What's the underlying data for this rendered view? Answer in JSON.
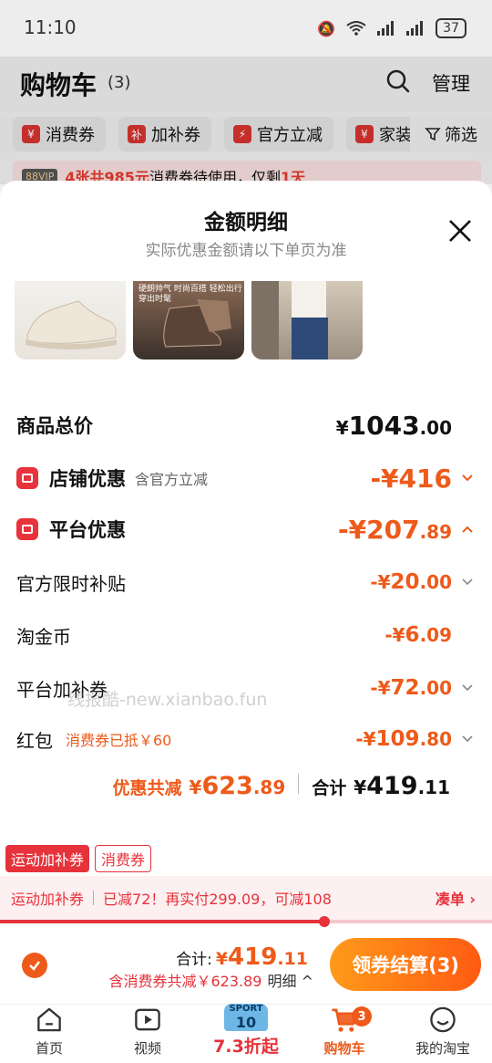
{
  "status_bar": {
    "time": "11:10",
    "battery": "37"
  },
  "header": {
    "title": "购物车",
    "count": "(3)",
    "manage": "管理"
  },
  "chips": [
    {
      "badge": "¥",
      "label": "消费券"
    },
    {
      "badge": "补",
      "label": "加补券"
    },
    {
      "badge": "⚡",
      "label": "官方立减"
    },
    {
      "badge": "¥",
      "label": "家装"
    }
  ],
  "filter_label": "筛选",
  "vip_bar": {
    "badge": "88VIP",
    "highlight": "4张共985元",
    "text": "消费券待使用，仅剩",
    "days": "1天"
  },
  "sheet": {
    "title": "金额明细",
    "subtitle": "实际优惠金额请以下单页为准",
    "thumbnail_tag": "硬朗帅气 时尚百搭 轻松出行 穿出时髦"
  },
  "rows": {
    "goods_total": {
      "label": "商品总价",
      "currency": "¥",
      "int": "1043",
      "dec": ".00"
    },
    "store_discount": {
      "label": "店铺优惠",
      "note": "含官方立减",
      "prefix": "-¥",
      "int": "416",
      "dec": ""
    },
    "platform_discount": {
      "label": "平台优惠",
      "prefix": "-¥",
      "int": "207",
      "dec": ".89"
    },
    "limited_subsidy": {
      "label": "官方限时补贴",
      "prefix": "-¥",
      "int": "20",
      "dec": ".00"
    },
    "taojinbi": {
      "label": "淘金币",
      "prefix": "-¥",
      "int": "6",
      "dec": ".09"
    },
    "platform_coupon": {
      "label": "平台加补券",
      "prefix": "-¥",
      "int": "72",
      "dec": ".00"
    },
    "red_packet": {
      "label": "红包",
      "note": "消费券已抵￥60",
      "prefix": "-¥",
      "int": "109",
      "dec": ".80"
    }
  },
  "watermark": "线报酷-new.xianbao.fun",
  "summary": {
    "discount_label": "优惠共减",
    "discount_prefix": "¥",
    "discount_int": "623",
    "discount_dec": ".89",
    "total_label": "合计",
    "total_prefix": "¥",
    "total_int": "419",
    "total_dec": ".11"
  },
  "tags": {
    "a": "运动加补券",
    "b": "消费券"
  },
  "promo_bar": {
    "name": "运动加补券",
    "text": "已减72！再实付299.09，可减108",
    "link": "凑单 ›"
  },
  "checkout": {
    "total_label": "合计:",
    "total_prefix": "¥",
    "total_int": "419",
    "total_dec": ".11",
    "sub_text": "含消费券共减￥623.89",
    "detail": "明细 ^",
    "button": "领券结算(3)"
  },
  "tabs": [
    {
      "label": "首页"
    },
    {
      "label": "视频"
    },
    {
      "label": "7.3折起",
      "jersey_top": "SPORT",
      "jersey_num": "10"
    },
    {
      "label": "购物车",
      "badge": "3"
    },
    {
      "label": "我的淘宝"
    }
  ],
  "colors": {
    "accent": "#ee5a1a",
    "red": "#e6323a"
  },
  "progress_fraction": 0.66
}
